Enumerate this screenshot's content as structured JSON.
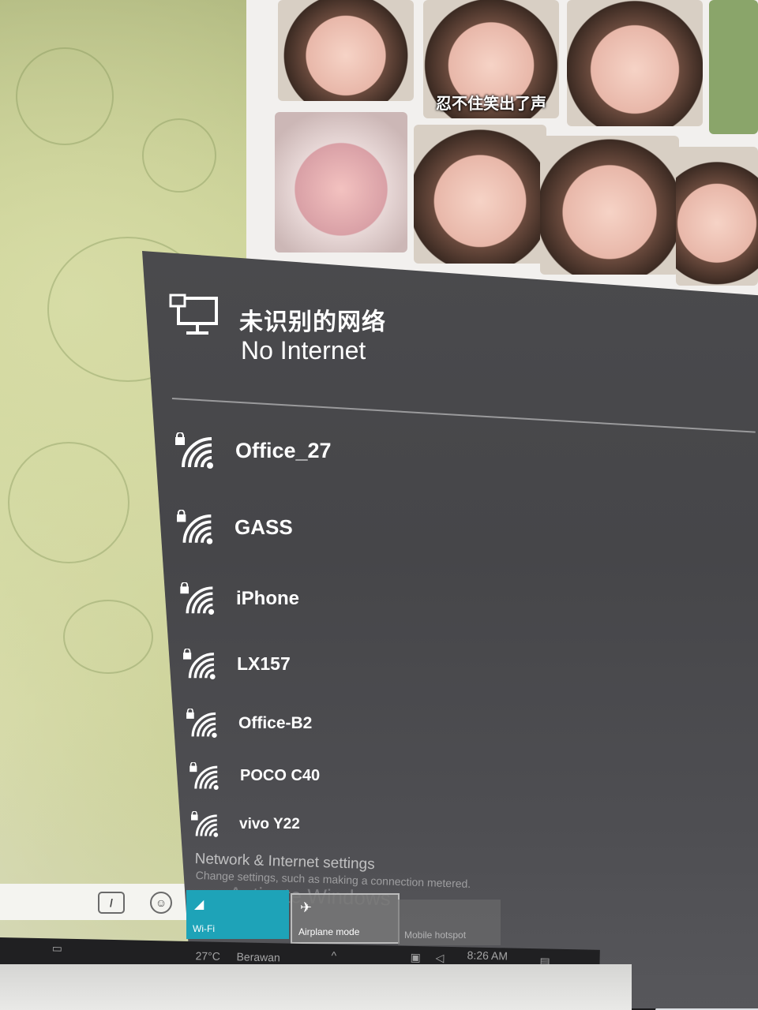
{
  "stickers": [
    {
      "caption": ""
    },
    {
      "caption": "忍不住笑出了声"
    },
    {
      "caption": ""
    },
    {
      "caption": ""
    },
    {
      "caption": ""
    },
    {
      "caption": ""
    },
    {
      "caption": ""
    },
    {
      "caption": ""
    }
  ],
  "flyout": {
    "network_name": "未识别的网络",
    "status": "No Internet",
    "networks": [
      {
        "ssid": "Office_27",
        "secured": true,
        "icon": "wifi-lock-icon"
      },
      {
        "ssid": "GASS",
        "secured": true,
        "icon": "wifi-lock-icon"
      },
      {
        "ssid": "iPhone",
        "secured": true,
        "icon": "wifi-lock-icon"
      },
      {
        "ssid": "LX157",
        "secured": true,
        "icon": "wifi-lock-icon"
      },
      {
        "ssid": "Office-B2",
        "secured": true,
        "icon": "wifi-lock-icon"
      },
      {
        "ssid": "POCO C40",
        "secured": true,
        "icon": "wifi-lock-icon"
      },
      {
        "ssid": "vivo Y22",
        "secured": true,
        "icon": "wifi-lock-icon"
      }
    ],
    "settings_link": "Network & Internet settings",
    "settings_desc": "Change settings, such as making a connection metered.",
    "watermark": "Activate Windows",
    "quick_tiles": [
      {
        "label": "Wi-Fi",
        "active": true
      },
      {
        "label": "Airplane mode",
        "active": false
      },
      {
        "label": "Mobile hotspot",
        "active": false
      }
    ]
  },
  "taskbar": {
    "weather": "27°C",
    "weather_desc": "Berawan",
    "time": "8:26 AM"
  },
  "colors": {
    "panel": "#48484b",
    "wifi_tile": "#1ea3b8",
    "text": "#ffffff"
  }
}
